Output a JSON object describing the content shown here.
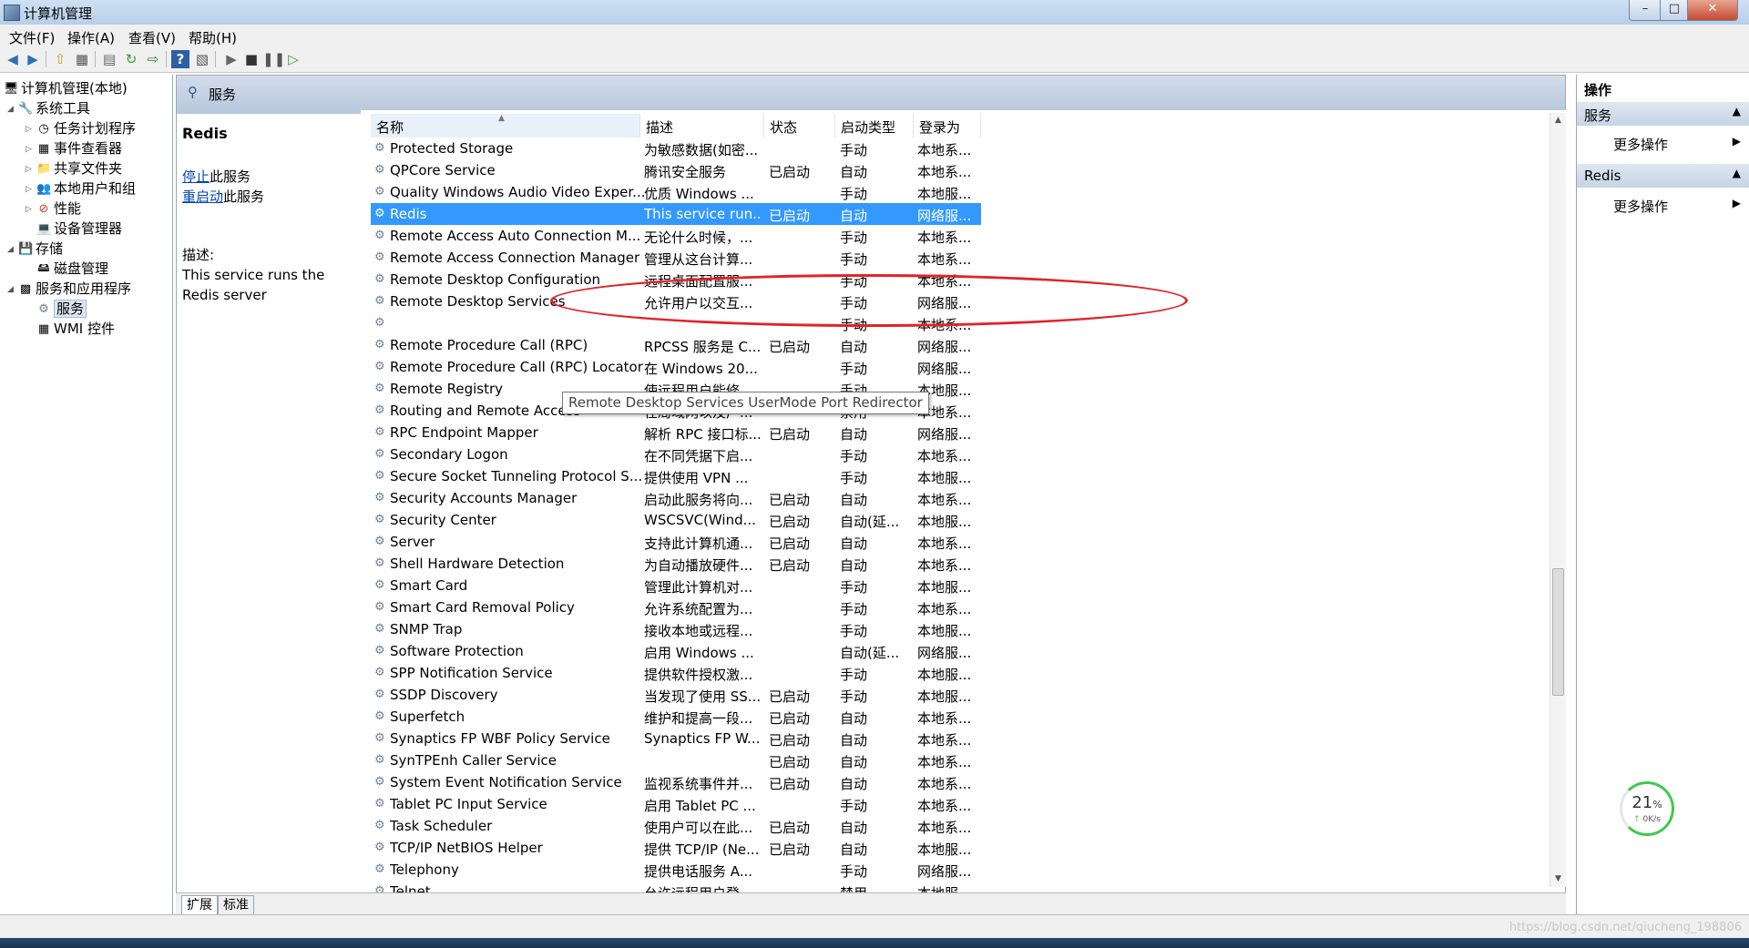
{
  "window": {
    "title": "计算机管理"
  },
  "menu": [
    "文件(F)",
    "操作(A)",
    "查看(V)",
    "帮助(H)"
  ],
  "tree": {
    "root": "计算机管理(本地)",
    "system_tools": "系统工具",
    "task_scheduler": "任务计划程序",
    "event_viewer": "事件查看器",
    "shared_folders": "共享文件夹",
    "local_users": "本地用户和组",
    "performance": "性能",
    "device_manager": "设备管理器",
    "storage": "存储",
    "disk_management": "磁盘管理",
    "services_apps": "服务和应用程序",
    "services": "服务",
    "wmi": "WMI 控件"
  },
  "middle": {
    "header_title": "服务",
    "selected_service": "Redis",
    "stop_link": "停止",
    "stop_suffix": "此服务",
    "restart_link": "重启动",
    "restart_suffix": "此服务",
    "desc_label": "描述:",
    "desc_text": "This service runs the Redis server"
  },
  "columns": {
    "name": "名称",
    "desc": "描述",
    "status": "状态",
    "startup": "启动类型",
    "logon": "登录为"
  },
  "rows": [
    {
      "name": "Protected Storage",
      "desc": "为敏感数据(如密...",
      "status": "",
      "startup": "手动",
      "logon": "本地系..."
    },
    {
      "name": "QPCore Service",
      "desc": "腾讯安全服务",
      "status": "已启动",
      "startup": "自动",
      "logon": "本地系..."
    },
    {
      "name": "Quality Windows Audio Video Exper...",
      "desc": "优质 Windows ...",
      "status": "",
      "startup": "手动",
      "logon": "本地服..."
    },
    {
      "name": "Redis",
      "desc": "This service run...",
      "status": "已启动",
      "startup": "自动",
      "logon": "网络服..."
    },
    {
      "name": "Remote Access Auto Connection M...",
      "desc": "无论什么时候，...",
      "status": "",
      "startup": "手动",
      "logon": "本地系..."
    },
    {
      "name": "Remote Access Connection Manager",
      "desc": "管理从这台计算...",
      "status": "",
      "startup": "手动",
      "logon": "本地系..."
    },
    {
      "name": "Remote Desktop Configuration",
      "desc": "远程桌面配置服...",
      "status": "",
      "startup": "手动",
      "logon": "本地系..."
    },
    {
      "name": "Remote Desktop Services",
      "desc": "允许用户以交互...",
      "status": "",
      "startup": "手动",
      "logon": "网络服..."
    },
    {
      "name": "",
      "desc": "",
      "status": "",
      "startup": "手动",
      "logon": "本地系..."
    },
    {
      "name": "Remote Procedure Call (RPC)",
      "desc": "RPCSS 服务是 C...",
      "status": "已启动",
      "startup": "自动",
      "logon": "网络服..."
    },
    {
      "name": "Remote Procedure Call (RPC) Locator",
      "desc": "在 Windows 20...",
      "status": "",
      "startup": "手动",
      "logon": "网络服..."
    },
    {
      "name": "Remote Registry",
      "desc": "使远程用户能修...",
      "status": "",
      "startup": "手动",
      "logon": "本地服..."
    },
    {
      "name": "Routing and Remote Access",
      "desc": "在局域网以及广...",
      "status": "",
      "startup": "禁用",
      "logon": "本地系..."
    },
    {
      "name": "RPC Endpoint Mapper",
      "desc": "解析 RPC 接口标...",
      "status": "已启动",
      "startup": "自动",
      "logon": "网络服..."
    },
    {
      "name": "Secondary Logon",
      "desc": "在不同凭据下启...",
      "status": "",
      "startup": "手动",
      "logon": "本地系..."
    },
    {
      "name": "Secure Socket Tunneling Protocol S...",
      "desc": "提供使用 VPN ...",
      "status": "",
      "startup": "手动",
      "logon": "本地服..."
    },
    {
      "name": "Security Accounts Manager",
      "desc": "启动此服务将向...",
      "status": "已启动",
      "startup": "自动",
      "logon": "本地系..."
    },
    {
      "name": "Security Center",
      "desc": "WSCSVC(Wind...",
      "status": "已启动",
      "startup": "自动(延...",
      "logon": "本地服..."
    },
    {
      "name": "Server",
      "desc": "支持此计算机通...",
      "status": "已启动",
      "startup": "自动",
      "logon": "本地系..."
    },
    {
      "name": "Shell Hardware Detection",
      "desc": "为自动播放硬件...",
      "status": "已启动",
      "startup": "自动",
      "logon": "本地系..."
    },
    {
      "name": "Smart Card",
      "desc": "管理此计算机对...",
      "status": "",
      "startup": "手动",
      "logon": "本地服..."
    },
    {
      "name": "Smart Card Removal Policy",
      "desc": "允许系统配置为...",
      "status": "",
      "startup": "手动",
      "logon": "本地系..."
    },
    {
      "name": "SNMP Trap",
      "desc": "接收本地或远程...",
      "status": "",
      "startup": "手动",
      "logon": "本地服..."
    },
    {
      "name": "Software Protection",
      "desc": "启用 Windows ...",
      "status": "",
      "startup": "自动(延...",
      "logon": "网络服..."
    },
    {
      "name": "SPP Notification Service",
      "desc": "提供软件授权激...",
      "status": "",
      "startup": "手动",
      "logon": "本地服..."
    },
    {
      "name": "SSDP Discovery",
      "desc": "当发现了使用 SS...",
      "status": "已启动",
      "startup": "手动",
      "logon": "本地服..."
    },
    {
      "name": "Superfetch",
      "desc": "维护和提高一段...",
      "status": "已启动",
      "startup": "自动",
      "logon": "本地系..."
    },
    {
      "name": "Synaptics FP WBF Policy Service",
      "desc": "Synaptics FP W...",
      "status": "已启动",
      "startup": "自动",
      "logon": "本地系..."
    },
    {
      "name": "SynTPEnh Caller Service",
      "desc": "",
      "status": "已启动",
      "startup": "自动",
      "logon": "本地系..."
    },
    {
      "name": "System Event Notification Service",
      "desc": "监视系统事件并...",
      "status": "已启动",
      "startup": "自动",
      "logon": "本地系..."
    },
    {
      "name": "Tablet PC Input Service",
      "desc": "启用 Tablet PC ...",
      "status": "",
      "startup": "手动",
      "logon": "本地系..."
    },
    {
      "name": "Task Scheduler",
      "desc": "使用户可以在此...",
      "status": "已启动",
      "startup": "自动",
      "logon": "本地系..."
    },
    {
      "name": "TCP/IP NetBIOS Helper",
      "desc": "提供 TCP/IP (Ne...",
      "status": "已启动",
      "startup": "自动",
      "logon": "本地服..."
    },
    {
      "name": "Telephony",
      "desc": "提供电话服务 A...",
      "status": "",
      "startup": "手动",
      "logon": "网络服..."
    },
    {
      "name": "Telnet",
      "desc": "允许远程用户登...",
      "status": "",
      "startup": "禁用",
      "logon": "本地服..."
    }
  ],
  "selected_row_index": 3,
  "tooltip": "Remote Desktop Services UserMode Port Redirector",
  "bottom_tabs": [
    "扩展",
    "标准"
  ],
  "actions": {
    "title": "操作",
    "group1": "服务",
    "group1_item": "更多操作",
    "group2": "Redis",
    "group2_item": "更多操作"
  },
  "gauge": {
    "percent": "21",
    "percent_sign": "%",
    "rate": "0K/s"
  },
  "watermark": "https://blog.csdn.net/qiucheng_198806",
  "colors": {
    "selection": "#3399ff",
    "annotation": "#e0232a",
    "link": "#0045b5"
  }
}
